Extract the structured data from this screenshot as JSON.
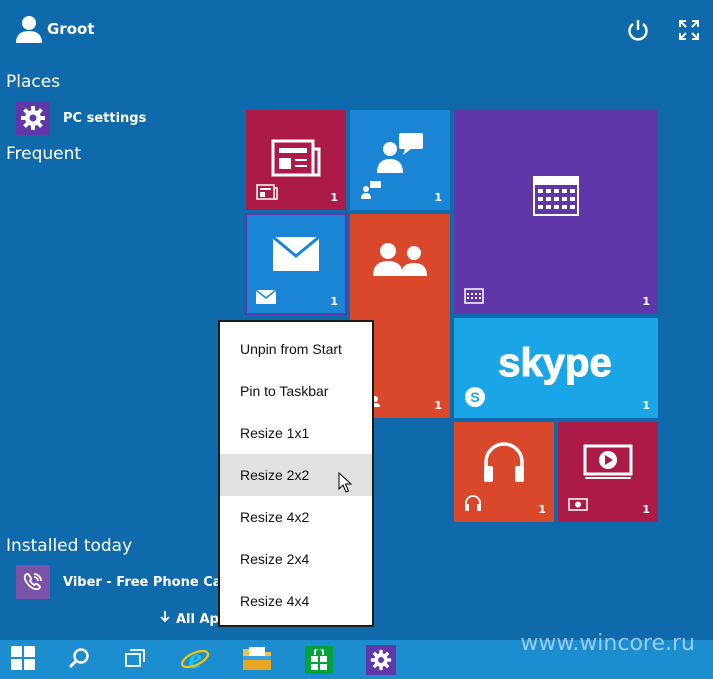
{
  "user": {
    "name": "Groot"
  },
  "sections": {
    "places": "Places",
    "frequent": "Frequent",
    "installed_today": "Installed today"
  },
  "places_items": [
    {
      "label": "PC settings",
      "icon": "gear-icon"
    }
  ],
  "installed_items": [
    {
      "label": "Viber - Free Phone Calls",
      "icon": "viber-icon"
    }
  ],
  "all_apps": {
    "label": "All Apps",
    "icon": "arrow-down-icon"
  },
  "tiles": {
    "news": {
      "badge": "1",
      "color": "#ac1a48"
    },
    "people_chat": {
      "badge": "1",
      "color": "#1a85d5"
    },
    "calendar": {
      "badge": "1",
      "color": "#5f37a8"
    },
    "mail": {
      "badge": "1",
      "color": "#1a85d5"
    },
    "people": {
      "badge": "1",
      "color": "#d9482a"
    },
    "skype": {
      "badge": "1",
      "label": "skype",
      "color": "#1aa6e6"
    },
    "music": {
      "badge": "1",
      "color": "#d9482a"
    },
    "video": {
      "badge": "1",
      "color": "#ac1a48"
    }
  },
  "context_menu": {
    "items": [
      "Unpin from Start",
      "Pin to Taskbar",
      "Resize 1x1",
      "Resize 2x2",
      "Resize 4x2",
      "Resize 2x4",
      "Resize 4x4"
    ],
    "hovered_index": 3
  },
  "taskbar": {
    "buttons": [
      "windows-start-icon",
      "search-icon",
      "task-view-icon",
      "internet-explorer-icon",
      "file-explorer-icon",
      "store-icon",
      "settings-icon"
    ]
  },
  "watermark": "www.wincore.ru",
  "colors": {
    "background": "#0f6aac",
    "taskbar": "#1c8ed0"
  }
}
